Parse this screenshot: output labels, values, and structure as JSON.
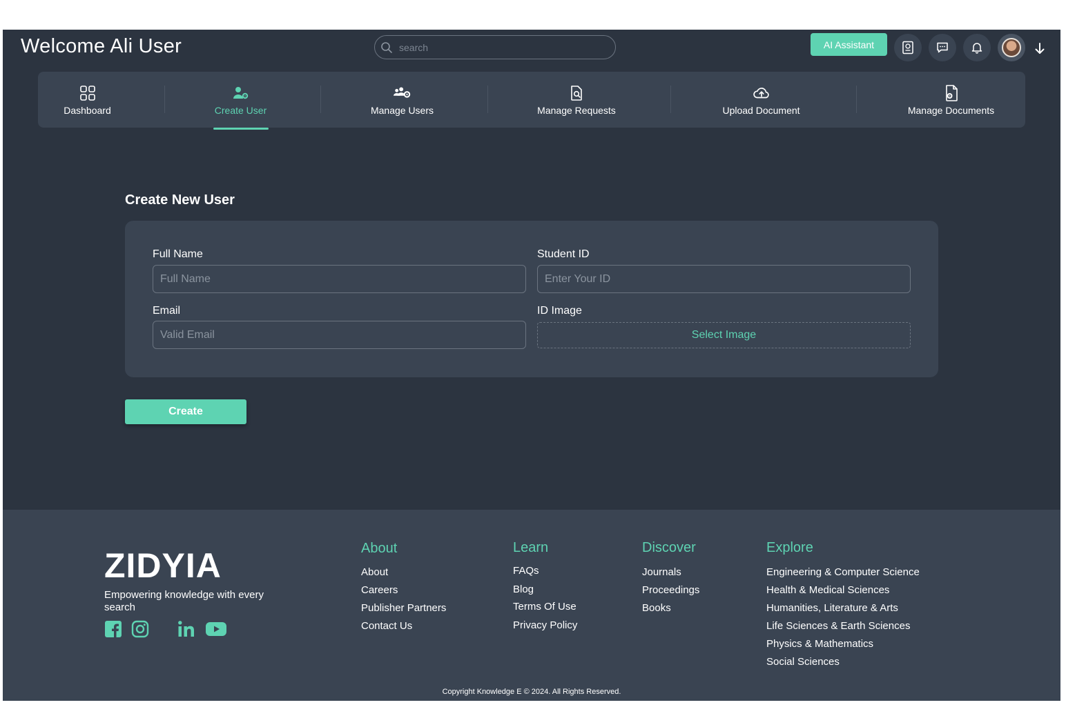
{
  "header": {
    "welcome": "Welcome Ali User",
    "search_placeholder": "search",
    "ai_button": "AI Assistant"
  },
  "nav": {
    "items": [
      {
        "label": "Dashboard",
        "icon": "grid-icon"
      },
      {
        "label": "Create User",
        "icon": "user-gear-icon"
      },
      {
        "label": "Manage Users",
        "icon": "users-gear-icon"
      },
      {
        "label": "Manage Requests",
        "icon": "document-search-icon"
      },
      {
        "label": "Upload Document",
        "icon": "cloud-upload-icon"
      },
      {
        "label": "Manage Documents",
        "icon": "document-gear-icon"
      }
    ],
    "active": "Create User"
  },
  "form": {
    "title": "Create New User",
    "full_name_label": "Full Name",
    "full_name_placeholder": "Full Name",
    "student_id_label": "Student ID",
    "student_id_placeholder": "Enter Your ID",
    "email_label": "Email",
    "email_placeholder": "Valid Email",
    "id_image_label": "ID Image",
    "select_image": "Select Image",
    "create_button": "Create"
  },
  "footer": {
    "logo": "ZIDYIA",
    "tagline": "Empowering knowledge with every search",
    "columns": [
      {
        "heading": "About",
        "links": [
          "About",
          "Careers",
          "Publisher Partners",
          "Contact Us"
        ]
      },
      {
        "heading": "Learn",
        "links": [
          "FAQs",
          "Blog",
          "Terms Of Use",
          "Privacy Policy"
        ]
      },
      {
        "heading": "Discover",
        "links": [
          "Journals",
          "Proceedings",
          "Books"
        ]
      },
      {
        "heading": "Explore",
        "links": [
          "Engineering & Computer Science",
          "Health & Medical Sciences",
          "Humanities, Literature & Arts",
          "Life Sciences & Earth Sciences",
          "Physics & Mathematics",
          "Social Sciences"
        ]
      }
    ],
    "copyright": "Copyright Knowledge E © 2024. All Rights Reserved."
  },
  "colors": {
    "accent": "#5ed3b2",
    "background": "#2c3440",
    "panel": "#3a4452"
  }
}
